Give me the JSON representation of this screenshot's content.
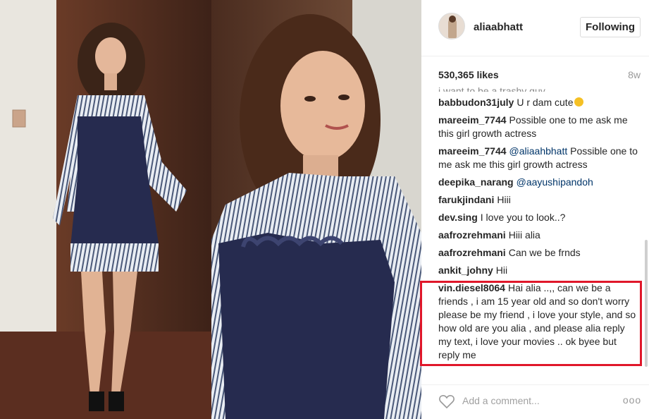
{
  "post": {
    "username": "aliaabhatt",
    "follow_label": "Following",
    "likes": "530,365 likes",
    "time_ago": "8w"
  },
  "comments": [
    {
      "user": "babbudon31july",
      "text": "U r dam cute",
      "emoji": "blush-emoji"
    },
    {
      "user": "mareeim_7744",
      "text": "Possible one to me ask me this girl growth actress"
    },
    {
      "user": "mareeim_7744",
      "mention": "@aliaahbhatt",
      "text": "Possible one to me ask me this girl growth actress"
    },
    {
      "user": "deepika_narang",
      "mention": "@aayushipandoh",
      "text": ""
    },
    {
      "user": "farukjindani",
      "text": "Hiii"
    },
    {
      "user": "dev.sing",
      "text": "I love you to look..?"
    },
    {
      "user": "aafrozrehmani",
      "text": "Hiii alia"
    },
    {
      "user": "aafrozrehmani",
      "text": "Can we be frnds"
    },
    {
      "user": "ankit_johny",
      "text": "Hii"
    },
    {
      "user": "vin.diesel8064",
      "text": "Hai alia ..,, can we be a friends , i am 15 year old and so don't worry please be my friend , i love your style, and so how old are you alia , and please alia reply my text, i love your movies .. ok byee but reply me"
    }
  ],
  "footer": {
    "comment_placeholder": "Add a comment...",
    "more_label": "ooo"
  },
  "colors": {
    "highlight": "#e0172a",
    "mention": "#003569",
    "dress": "#262b4f"
  },
  "icons": [
    "heart-icon",
    "more-options-icon",
    "blush-emoji"
  ]
}
